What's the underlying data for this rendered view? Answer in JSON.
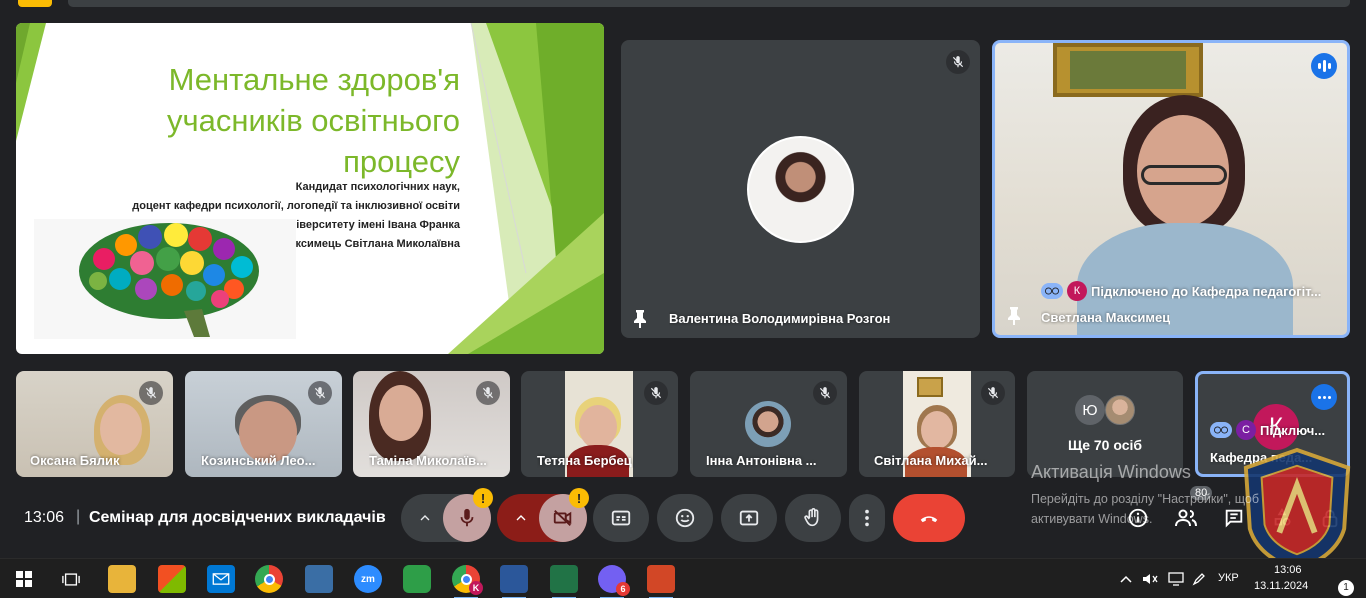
{
  "presentation": {
    "title_lines": [
      "Ментальне здоров'я",
      "учасників освітнього",
      "процесу"
    ],
    "subtitle_lines": [
      "Кандидат психологічних наук,",
      "доцент кафедри психології, логопедії та інклюзивної освіти",
      "університету імені Івана Франка",
      "Максимець Світлана Миколаївна"
    ]
  },
  "tiles": {
    "main_left_name": "Валентина Володимирівна Розгон",
    "main_right_name": "Светлана Максимец",
    "main_right_status": "Підключено до Кафедра педагогіт...",
    "main_right_status_initial": "К",
    "strip": [
      {
        "name": "Оксана Бялик"
      },
      {
        "name": "Козинський Лео..."
      },
      {
        "name": "Таміла Миколаїв..."
      },
      {
        "name": "Тетяна Бербец"
      },
      {
        "name": "Інна Антонівна ..."
      },
      {
        "name": "Світлана Михай..."
      }
    ],
    "others_initial": "Ю",
    "others_label": "Ще 70 осіб",
    "last_tile_initial": "К",
    "last_tile_small_initial": "С",
    "last_tile_status": "Підключ...",
    "last_tile_name": "Кафедра педа..."
  },
  "meeting": {
    "time": "13:06",
    "separator": "|",
    "title": "Семінар для досвідчених викладачів",
    "warn_mark": "!",
    "participants_count": "80"
  },
  "watermark": {
    "line1": "Активація Windows",
    "line2": "Перейдіть до розділу \"Настройки\", щоб",
    "line3": "активувати Windows."
  },
  "taskbar": {
    "zoom_label": "zm",
    "chrome_badge": "K",
    "viber_badge": "6",
    "language": "УКР",
    "time": "13:06",
    "date": "13.11.2024",
    "notifications": "1"
  },
  "colors": {
    "background": "#202124",
    "tile": "#3c4043",
    "accent_blue": "#1a73e8",
    "highlight_border": "#8ab4f8",
    "end_call": "#ea4335",
    "warn": "#fbbc04",
    "slide_green": "#7cb82a"
  }
}
